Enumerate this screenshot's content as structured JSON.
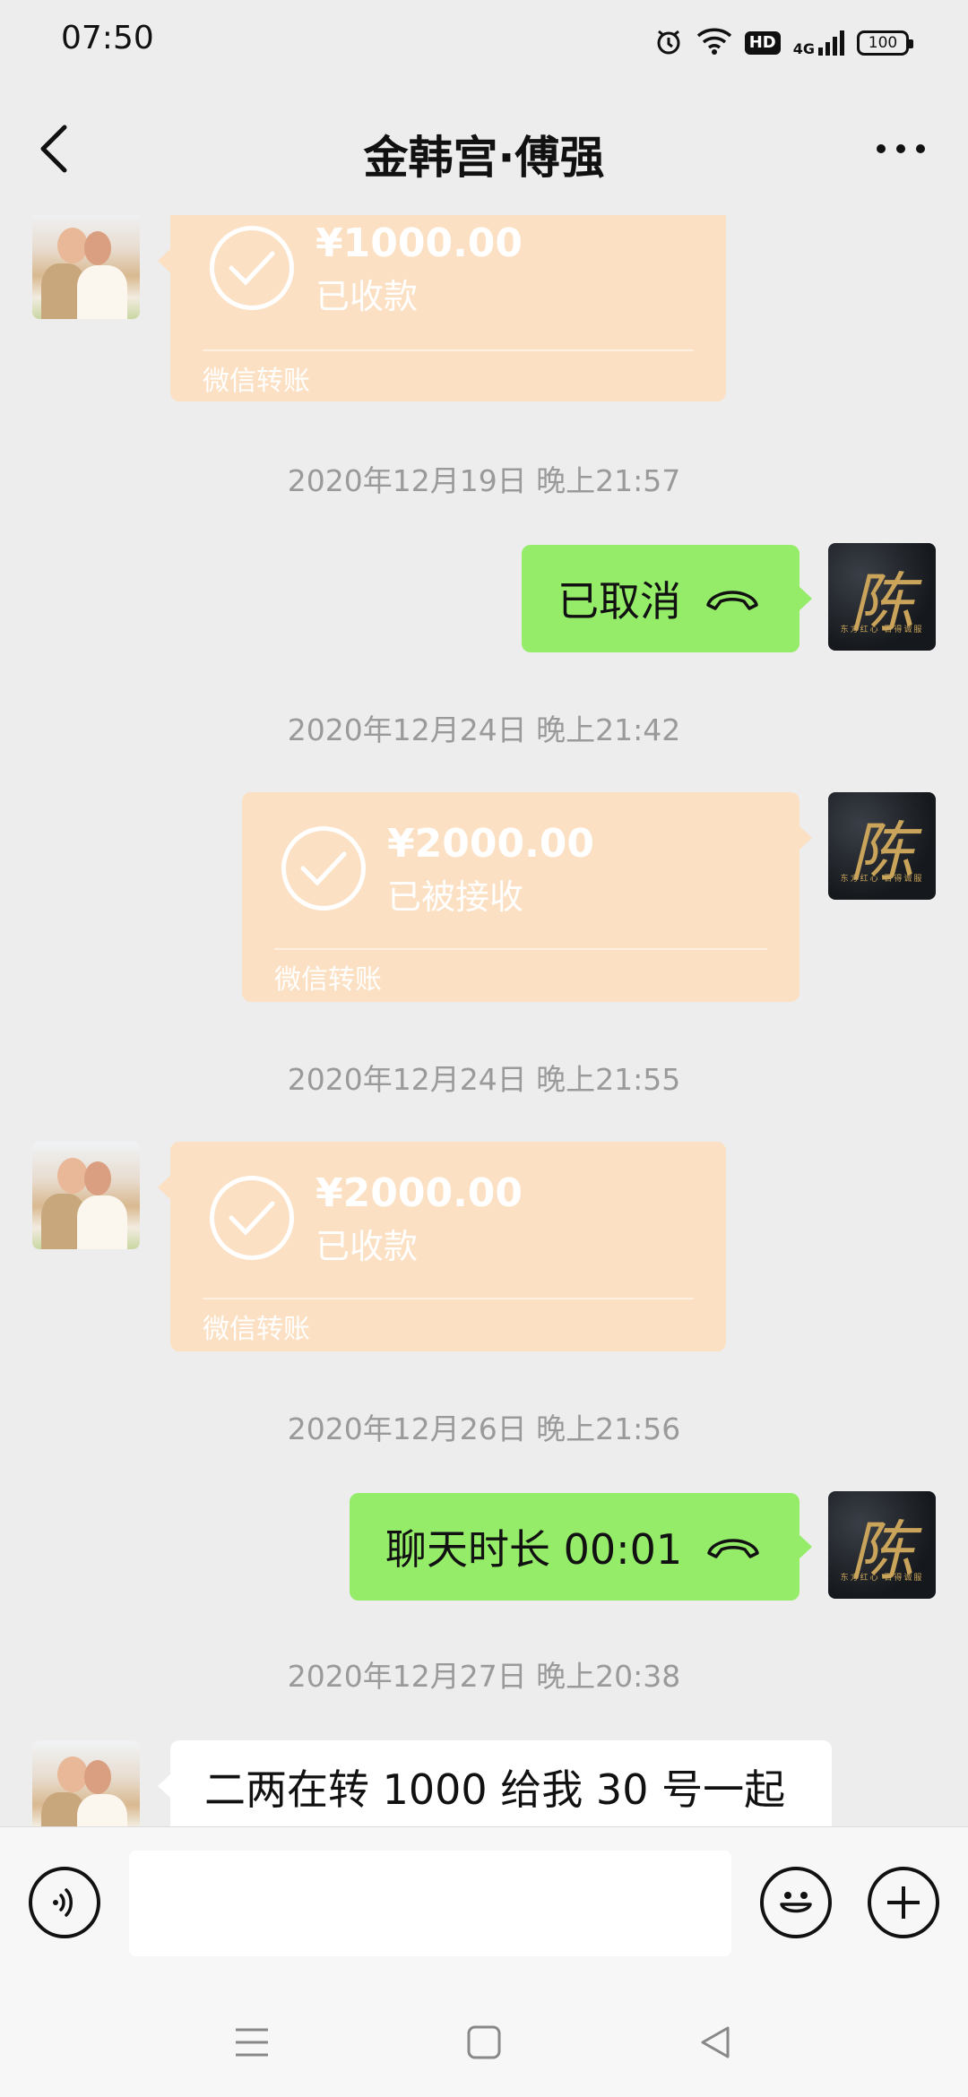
{
  "status_bar": {
    "time": "07:50",
    "hd_label": "HD",
    "network_label": "4G",
    "battery": "100"
  },
  "header": {
    "title": "金韩宫·傅强"
  },
  "contact_avatar_logo": {
    "glyph": "陈",
    "tagline": "东方红心 百得诚服"
  },
  "messages": [
    {
      "type": "transfer",
      "side": "left",
      "amount": "¥1000.00",
      "status": "已收款",
      "brand": "微信转账"
    },
    {
      "type": "timestamp",
      "text": "2020年12月19日 晚上21:57"
    },
    {
      "type": "call",
      "side": "right",
      "text": "已取消"
    },
    {
      "type": "timestamp",
      "text": "2020年12月24日 晚上21:42"
    },
    {
      "type": "transfer",
      "side": "right",
      "amount": "¥2000.00",
      "status": "已被接收",
      "brand": "微信转账"
    },
    {
      "type": "timestamp",
      "text": "2020年12月24日 晚上21:55"
    },
    {
      "type": "transfer",
      "side": "left",
      "amount": "¥2000.00",
      "status": "已收款",
      "brand": "微信转账"
    },
    {
      "type": "timestamp",
      "text": "2020年12月26日 晚上21:56"
    },
    {
      "type": "call",
      "side": "right",
      "text": "聊天时长 00:01"
    },
    {
      "type": "timestamp",
      "text": "2020年12月27日 晚上20:38"
    },
    {
      "type": "text",
      "side": "left",
      "text": "二两在转 1000 给我 30 号一起"
    }
  ],
  "input": {
    "value": "",
    "placeholder": ""
  },
  "colors": {
    "transfer_bg": "#fce0c3",
    "sent_bubble": "#95ec69",
    "background": "#ededed"
  }
}
